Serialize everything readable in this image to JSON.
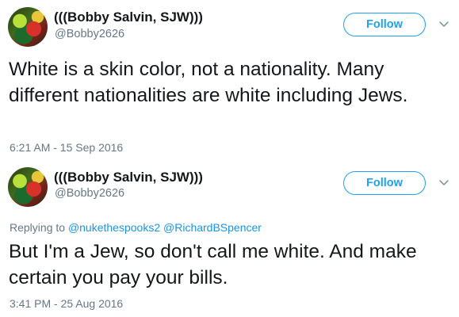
{
  "tweets": [
    {
      "display_name": "(((Bobby Salvin, SJW)))",
      "handle": "@Bobby2626",
      "follow_label": "Follow",
      "text": "White is a skin color, not a nationality.  Many different nationalities are white including Jews.",
      "timestamp": "6:21 AM - 15 Sep 2016"
    },
    {
      "display_name": "(((Bobby Salvin, SJW)))",
      "handle": "@Bobby2626",
      "follow_label": "Follow",
      "replying_to_prefix": "Replying to",
      "replying_to": [
        "@nukethespooks2",
        "@RichardBSpencer"
      ],
      "text": "But I'm a Jew, so don't call me white. And make certain you pay your bills.",
      "timestamp": "3:41 PM - 25 Aug 2016"
    }
  ],
  "colors": {
    "accent": "#1da1f2",
    "link": "#1b95e0",
    "secondary_text": "#657786",
    "primary_text": "#14171a"
  },
  "icons": {
    "menu": "chevron-down-icon"
  }
}
